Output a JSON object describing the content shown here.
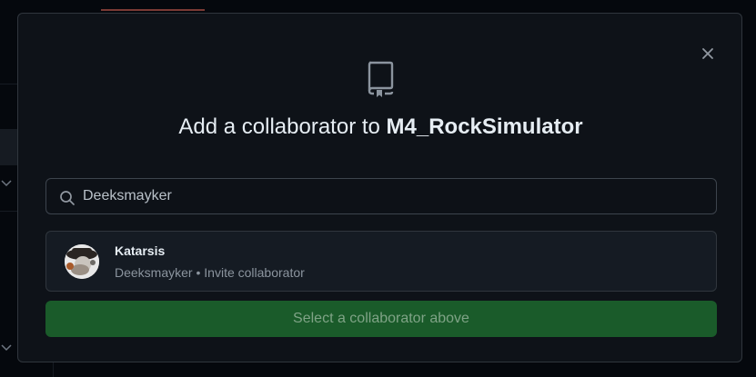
{
  "dialog": {
    "title_prefix": "Add a collaborator to ",
    "repo_name": "M4_RockSimulator",
    "close_icon": "x-icon",
    "repo_icon": "repo-icon"
  },
  "search": {
    "icon": "search-icon",
    "value": "Deeksmayker"
  },
  "result": {
    "name": "Katarsis",
    "username": "Deeksmayker",
    "separator": " • ",
    "action": "Invite collaborator"
  },
  "submit": {
    "label": "Select a collaborator above"
  },
  "colors": {
    "modal_bg": "#0e1218",
    "border": "#30363d",
    "button_disabled_bg": "#1a5b2a",
    "button_disabled_text": "#7fa386"
  }
}
